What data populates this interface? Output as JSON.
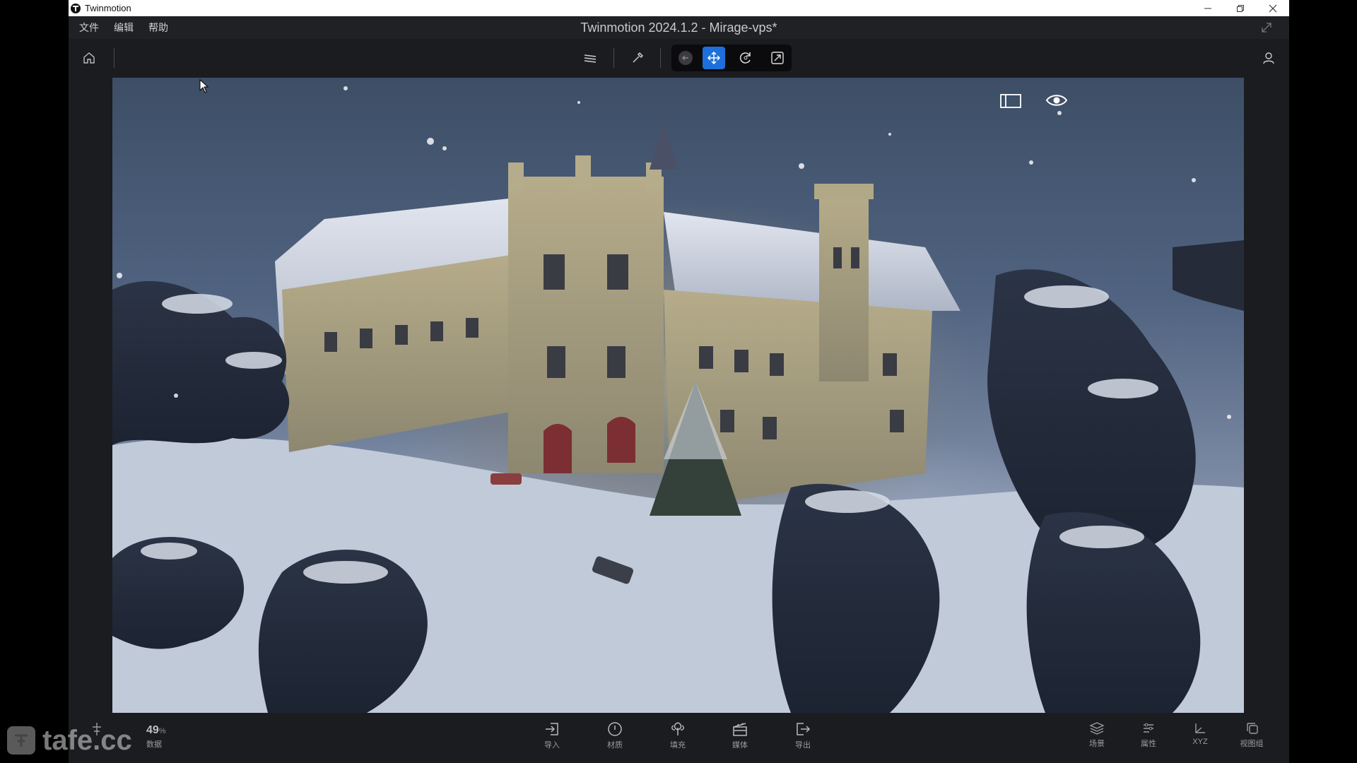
{
  "os_window": {
    "title": "Twinmotion",
    "controls": [
      "minimize-icon",
      "restore-icon",
      "close-icon"
    ]
  },
  "menu": {
    "items": [
      {
        "label": "文件"
      },
      {
        "label": "编辑"
      },
      {
        "label": "帮助"
      }
    ],
    "app_title": "Twinmotion 2024.1.2 - Mirage-vps*"
  },
  "toolbar": {
    "left": [
      "home-icon"
    ],
    "center": [
      "layers-icon",
      "eyedropper-icon",
      "back-icon",
      "move-icon",
      "rotate-icon",
      "scale-icon"
    ],
    "active_tool": "move",
    "right": [
      "user-icon"
    ]
  },
  "viewport": {
    "overlay_icons": [
      "panel-toggle-icon",
      "eye-icon"
    ]
  },
  "stats": {
    "value": "49",
    "unit": "%",
    "label": "数据"
  },
  "bottom_nav": [
    {
      "label": "导入",
      "icon": "import-icon"
    },
    {
      "label": "材质",
      "icon": "material-icon"
    },
    {
      "label": "填充",
      "icon": "populate-icon"
    },
    {
      "label": "媒体",
      "icon": "media-icon"
    },
    {
      "label": "导出",
      "icon": "export-icon"
    }
  ],
  "bottom_right": [
    {
      "label": "场景",
      "icon": "scene-icon"
    },
    {
      "label": "属性",
      "icon": "properties-icon"
    },
    {
      "label": "XYZ",
      "icon": "xyz-icon"
    },
    {
      "label": "视图组",
      "icon": "view-group-icon"
    }
  ],
  "watermark": {
    "text": "tafe.cc"
  },
  "colors": {
    "accent": "#1e6fd9",
    "panel": "#1b1c1f",
    "menubar": "#202125"
  }
}
